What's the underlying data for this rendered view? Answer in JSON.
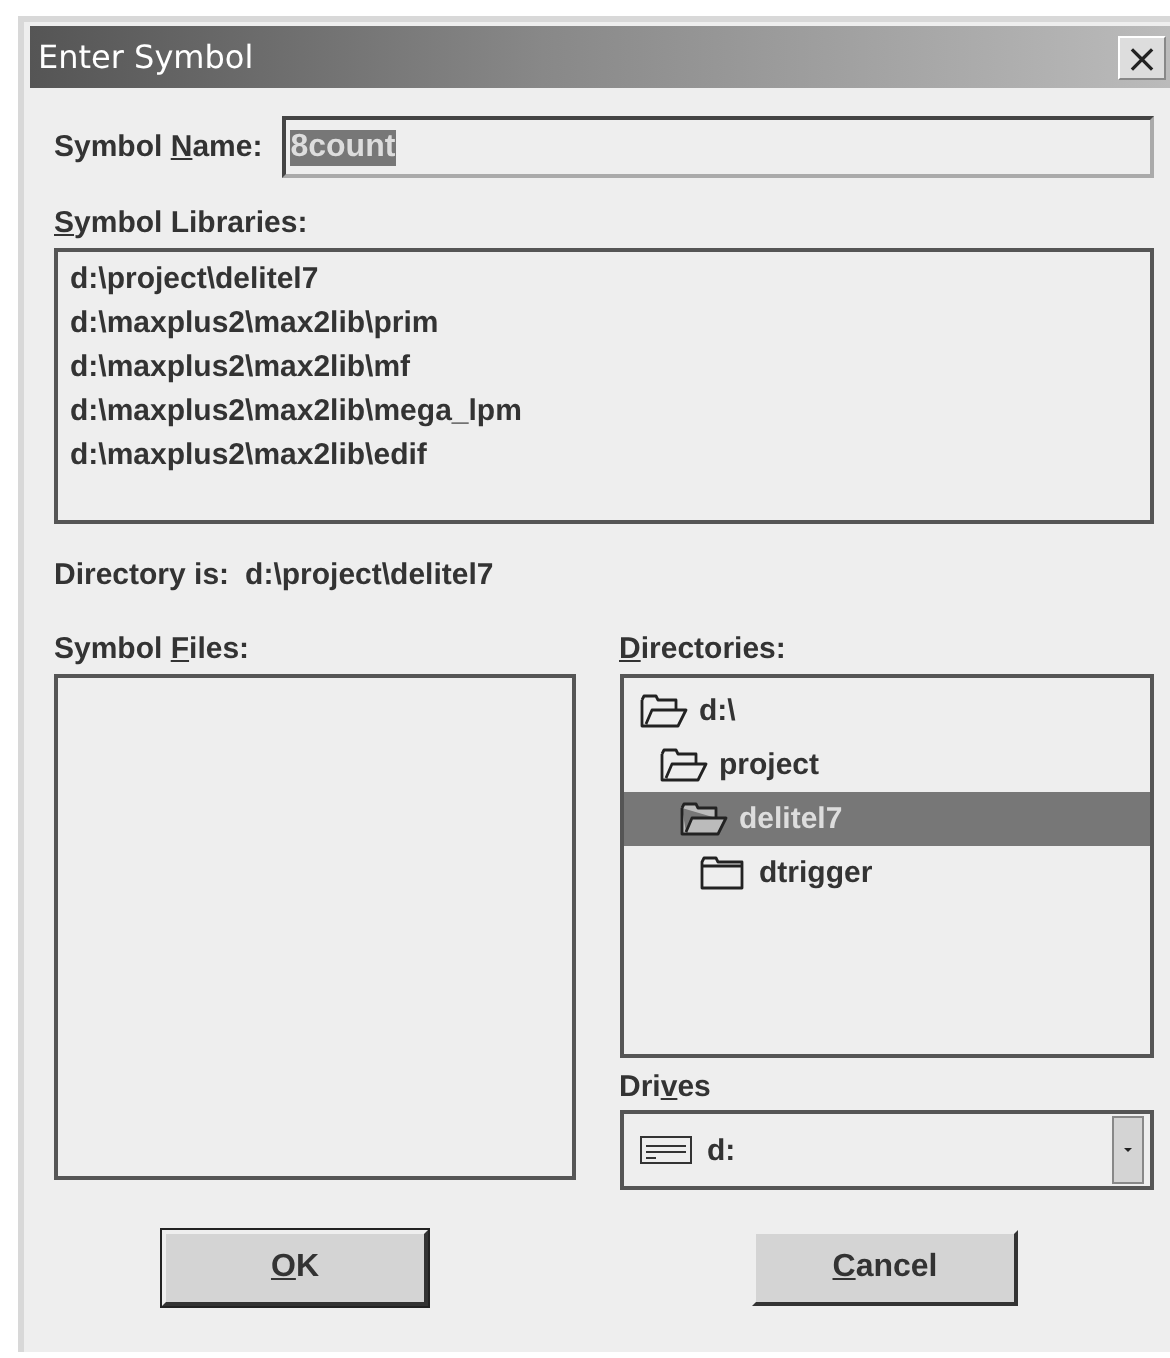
{
  "window": {
    "title": "Enter Symbol",
    "close": "×"
  },
  "symbol_name": {
    "label_parts": {
      "before": "Symbol ",
      "key": "N",
      "after": "ame:"
    },
    "value": "8count",
    "value_selected": true
  },
  "symbol_libraries": {
    "label_parts": {
      "key": "S",
      "after": "ymbol Libraries:"
    },
    "items": [
      "d:\\project\\delitel7",
      "d:\\maxplus2\\max2lib\\prim",
      "d:\\maxplus2\\max2lib\\mf",
      "d:\\maxplus2\\max2lib\\mega_lpm",
      "d:\\maxplus2\\max2lib\\edif"
    ]
  },
  "directory_is": {
    "label": "Directory is:",
    "value": "d:\\project\\delitel7"
  },
  "symbol_files": {
    "label_parts": {
      "before": "Symbol ",
      "key": "F",
      "after": "iles:"
    }
  },
  "directories": {
    "label_parts": {
      "key": "D",
      "after": "irectories:"
    },
    "tree": [
      {
        "name": "d:\\",
        "open": true,
        "selected": false,
        "children": [
          {
            "name": "project",
            "open": true,
            "selected": false,
            "children": [
              {
                "name": "delitel7",
                "open": true,
                "selected": true,
                "children": [
                  {
                    "name": "dtrigger",
                    "open": false,
                    "selected": false
                  }
                ]
              }
            ]
          }
        ]
      }
    ]
  },
  "drives": {
    "label_parts": {
      "before": "Dri",
      "key": "v",
      "after": "es"
    },
    "value": "d:"
  },
  "buttons": [
    {
      "label_parts": {
        "key": "O",
        "after": "K"
      },
      "default": true
    },
    {
      "label_parts": {
        "key": "C",
        "after": "ancel"
      },
      "default": false
    }
  ]
}
